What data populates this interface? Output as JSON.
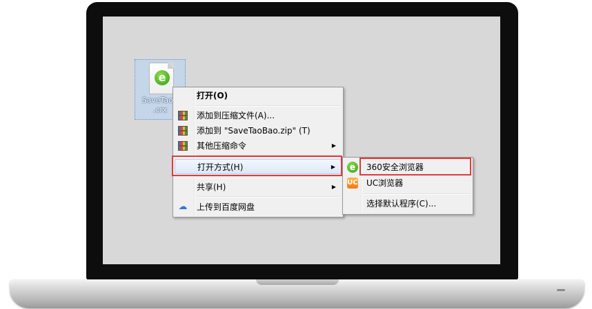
{
  "desktop": {
    "file_label_line1": "SaveTaoB",
    "file_label_line2": ".crx"
  },
  "context_menu": {
    "items": [
      {
        "label": "打开(O)"
      },
      {
        "label": "添加到压缩文件(A)..."
      },
      {
        "label": "添加到 \"SaveTaoBao.zip\" (T)"
      },
      {
        "label": "其他压缩命令"
      },
      {
        "label": "打开方式(H)"
      },
      {
        "label": "共享(H)"
      },
      {
        "label": "上传到百度网盘"
      }
    ],
    "submenu_arrow": "▶"
  },
  "open_with_submenu": {
    "items": [
      {
        "label": "360安全浏览器"
      },
      {
        "label": "UC浏览器"
      },
      {
        "label": "选择默认程序(C)..."
      }
    ]
  },
  "icons": {
    "file_icon": "360-browser-document-icon",
    "winrar": "winrar-icon",
    "baidu": "baidu-netdisk-icon",
    "browser_360": "360-browser-icon",
    "uc_browser": "uc-browser-icon"
  },
  "colors": {
    "highlight_box": "#e03a3a",
    "selection_bg": "#dce9f8",
    "desktop_bg": "#d8d8d8"
  }
}
